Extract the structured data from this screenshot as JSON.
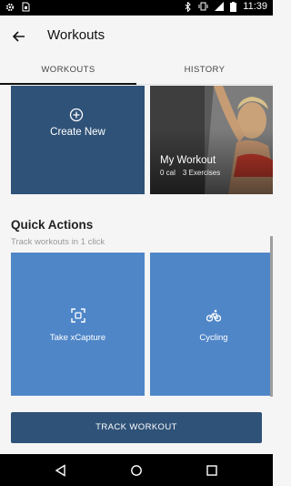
{
  "status_bar": {
    "time": "11:39",
    "left_icons": [
      "settings-icon",
      "sim-icon"
    ],
    "right_icons": [
      "bluetooth-icon",
      "vibrate-icon",
      "signal-icon",
      "battery-icon"
    ]
  },
  "app_bar": {
    "back_icon": "arrow-left-icon",
    "title": "Workouts"
  },
  "tabs": [
    {
      "label": "WORKOUTS",
      "active": true
    },
    {
      "label": "HISTORY",
      "active": false
    }
  ],
  "workout_cards": {
    "create": {
      "label": "Create New",
      "icon": "plus-circle-icon"
    },
    "my_workout": {
      "name": "My Workout",
      "calories": "0 cal",
      "exercises": "3 Exercises"
    }
  },
  "quick_actions": {
    "title": "Quick Actions",
    "subtitle": "Track workouts in 1 click",
    "items": [
      {
        "label": "Take xCapture",
        "icon": "scan-icon"
      },
      {
        "label": "Cycling",
        "icon": "bicycle-icon"
      }
    ]
  },
  "primary_action": {
    "label": "TRACK WORKOUT"
  },
  "nav_bar": {
    "icons": [
      "back-triangle-icon",
      "home-circle-icon",
      "recents-square-icon"
    ]
  },
  "colors": {
    "primary_dark": "#2f5278",
    "quick_action_blue": "#4f86c8",
    "background": "#f5f5f5"
  }
}
